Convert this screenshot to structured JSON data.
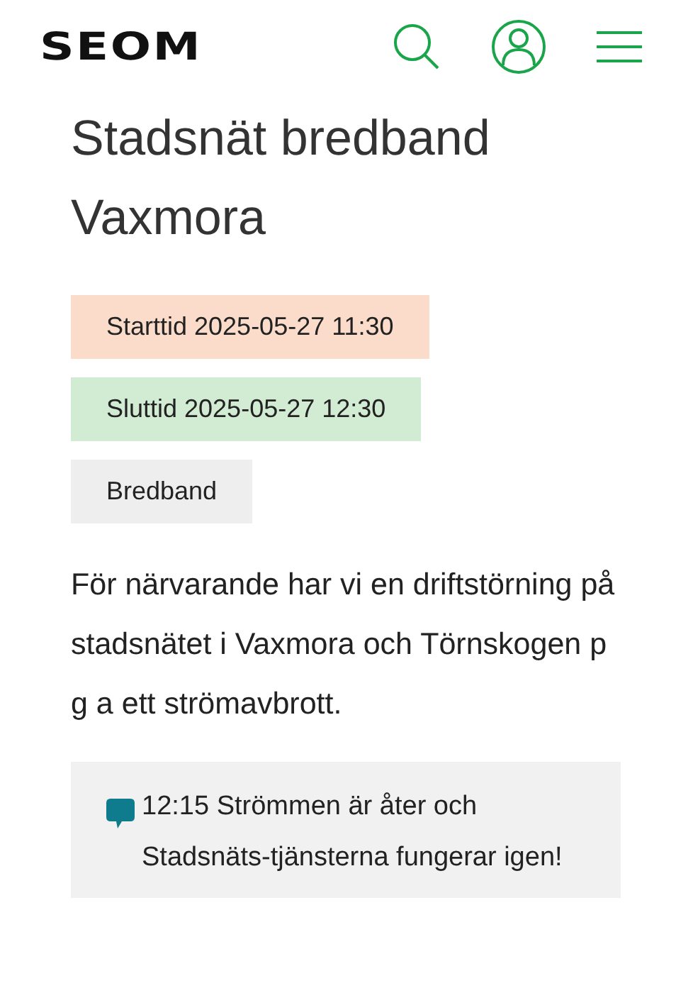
{
  "header": {
    "logo": "SEOM"
  },
  "title": "Stadsnät bredband Vaxmora",
  "tags": [
    {
      "kind": "start",
      "label": "Starttid 2025-05-27 11:30"
    },
    {
      "kind": "end",
      "label": "Sluttid 2025-05-27 12:30"
    },
    {
      "kind": "category",
      "label": "Bredband"
    }
  ],
  "description": "För närvarande har vi en driftstörning på stadsnätet i Vaxmora och Törnskogen p g a ett strömavbrott.",
  "updates": [
    {
      "text": "12:15 Strömmen är åter och Stadsnäts-tjänsterna fungerar igen!"
    }
  ]
}
